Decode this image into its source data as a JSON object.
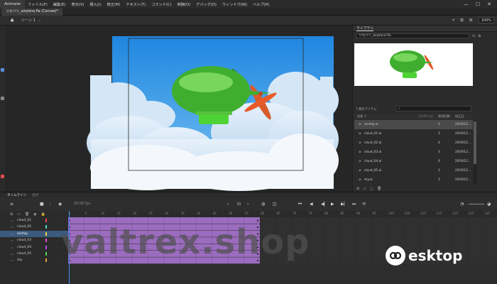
{
  "menubar": {
    "app_name": "Animate",
    "items": [
      "ファイル(F)",
      "編集(E)",
      "表示(V)",
      "挿入(I)",
      "修正(M)",
      "テキスト(T)",
      "コマンド(C)",
      "制御(O)",
      "デバッグ(D)",
      "ウィンドウ(W)",
      "ヘルプ(H)"
    ]
  },
  "document": {
    "tab_title": "リカバリ_airplane.fla (Canvas)*"
  },
  "editbar": {
    "scene_label": "シーン 1",
    "zoom": "100%"
  },
  "library": {
    "panel_title": "ライブラリ",
    "document_name": "リカバリ_airplane.fla",
    "item_count": "7 個のアイテム",
    "search_placeholder": "",
    "columns": {
      "name": "名前 ↑",
      "linkage": "リンケージ",
      "usage": "使用回数",
      "date": "修正日"
    },
    "items": [
      {
        "name": "airship.ai",
        "usage": "3",
        "date": "2019/12..."
      },
      {
        "name": "cloud_01.ai",
        "usage": "3",
        "date": "2019/12..."
      },
      {
        "name": "cloud_02.ai",
        "usage": "4",
        "date": "2019/12..."
      },
      {
        "name": "cloud_03.ai",
        "usage": "3",
        "date": "2019/12..."
      },
      {
        "name": "cloud_04.ai",
        "usage": "4",
        "date": "2019/12..."
      },
      {
        "name": "cloud_05.ai",
        "usage": "3",
        "date": "2019/12..."
      },
      {
        "name": "sky.ai",
        "usage": "3",
        "date": "2019/12..."
      }
    ]
  },
  "timeline": {
    "tab_active": "タイムライン",
    "tab_inactive": "出力",
    "fps": "30.00 fps",
    "frame_numbers": [
      "1",
      "5",
      "10",
      "15",
      "20",
      "25",
      "30",
      "35",
      "40",
      "45",
      "50",
      "55",
      "60",
      "65",
      "70",
      "75",
      "80",
      "85",
      "90",
      "95",
      "100",
      "105",
      "110",
      "115",
      "120",
      "125",
      "130",
      "135"
    ],
    "time_markers": [
      "1s",
      "2s",
      "3s",
      "4s"
    ],
    "layers": [
      {
        "name": "cloud_01",
        "color": "#e84b4b"
      },
      {
        "name": "cloud_02",
        "color": "#4bd9c4"
      },
      {
        "name": "airship",
        "color": "#e8d24b"
      },
      {
        "name": "cloud_03",
        "color": "#e84bd9"
      },
      {
        "name": "cloud_04",
        "color": "#b84be8"
      },
      {
        "name": "cloud_05",
        "color": "#4bd94b"
      },
      {
        "name": "sky",
        "color": "#e89b4b"
      }
    ]
  },
  "watermarks": {
    "left": "valtrex.shop",
    "right": "esktop"
  },
  "colors": {
    "frame_span": "#9b6cbf",
    "selected_layer": "#3c5a7e",
    "sky": "#3a9ae8",
    "airship_green": "#3fae2f"
  }
}
